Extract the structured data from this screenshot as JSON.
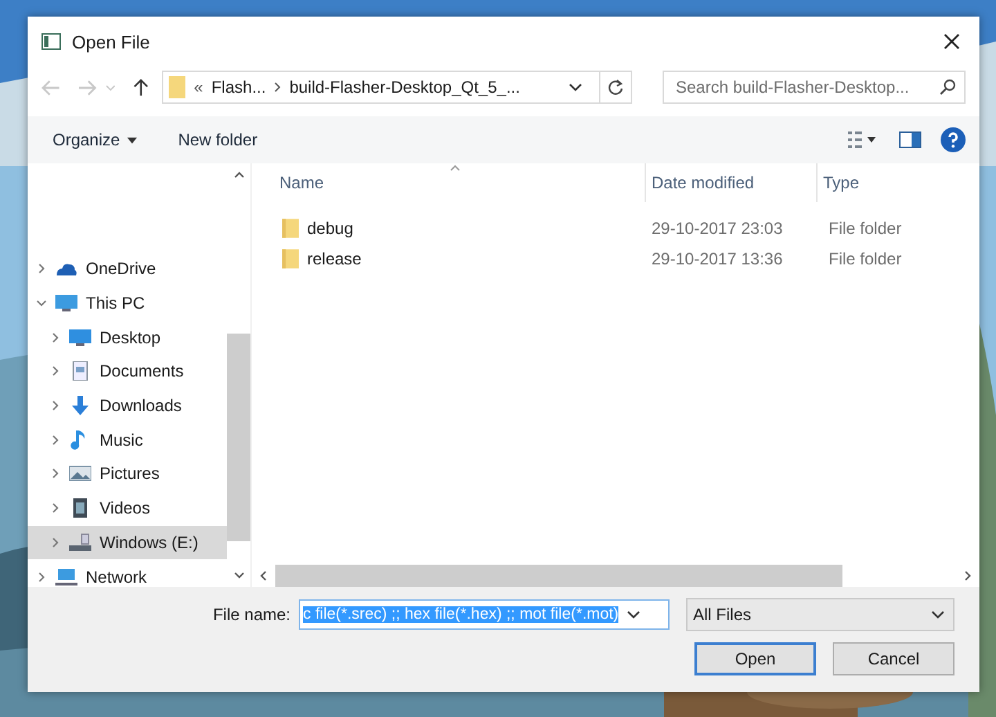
{
  "window": {
    "title": "Open File"
  },
  "nav": {
    "back_disabled": true,
    "forward_disabled": true,
    "up_disabled": false
  },
  "address": {
    "prefix": "«",
    "crumbs": [
      "Flash...",
      "build-Flasher-Desktop_Qt_5_..."
    ]
  },
  "search": {
    "placeholder": "Search build-Flasher-Desktop..."
  },
  "toolbar": [
    {
      "label": "Organize",
      "kind": "menu"
    },
    {
      "label": "New folder",
      "kind": "button"
    }
  ],
  "sidebar": {
    "items": [
      {
        "label": "OneDrive",
        "kind": "cloud",
        "expanded": false,
        "selected": false
      },
      {
        "label": "This PC",
        "kind": "pc",
        "expanded": true,
        "selected": false,
        "children": [
          {
            "label": "Desktop",
            "kind": "desktop",
            "expanded": false,
            "selected": false
          },
          {
            "label": "Documents",
            "kind": "doc",
            "expanded": false,
            "selected": false
          },
          {
            "label": "Downloads",
            "kind": "download",
            "expanded": false,
            "selected": false
          },
          {
            "label": "Music",
            "kind": "music",
            "expanded": false,
            "selected": false
          },
          {
            "label": "Pictures",
            "kind": "pictures",
            "expanded": false,
            "selected": false
          },
          {
            "label": "Videos",
            "kind": "videos",
            "expanded": false,
            "selected": false
          },
          {
            "label": "Windows (E:)",
            "kind": "drive",
            "expanded": false,
            "selected": true
          }
        ]
      },
      {
        "label": "Network",
        "kind": "network",
        "expanded": false,
        "selected": false
      }
    ]
  },
  "table": {
    "columns": [
      "Name",
      "Date modified",
      "Type"
    ],
    "rows": [
      {
        "name": "debug",
        "date": "29-10-2017 23:03",
        "type": "File folder"
      },
      {
        "name": "release",
        "date": "29-10-2017 13:36",
        "type": "File folder"
      }
    ]
  },
  "file_name": {
    "label": "File name:",
    "value": "c file(*.srec) ;; hex file(*.hex) ;; mot file(*.mot)",
    "text_selected": true
  },
  "filter": {
    "value": "All Files"
  },
  "buttons": [
    {
      "label": "Open",
      "default": true
    },
    {
      "label": "Cancel",
      "default": false
    }
  ]
}
